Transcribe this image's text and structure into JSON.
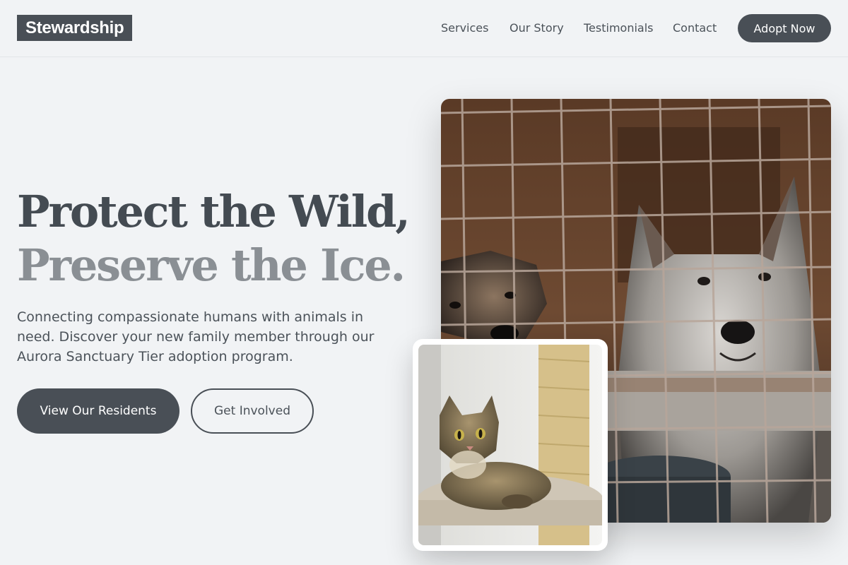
{
  "brand": {
    "logo_text": "Stewardship"
  },
  "nav": {
    "links": [
      "Services",
      "Our Story",
      "Testimonials",
      "Contact"
    ],
    "cta_label": "Adopt Now"
  },
  "hero": {
    "headline_line1": "Protect the Wild,",
    "headline_line2": "Preserve the Ice.",
    "lead": "Connecting compassionate humans with animals in need. Discover your new family member through our Aurora Sanctuary Tier adoption program.",
    "primary_button": "View Our Residents",
    "secondary_button": "Get Involved"
  },
  "images": {
    "main_alt": "Two dogs behind a wire kennel cage",
    "secondary_alt": "Tabby cat resting on a cat tree platform"
  },
  "colors": {
    "background": "#f1f3f5",
    "primary": "#494f56",
    "text_dark": "#444b52",
    "text_muted": "#8a8f94"
  }
}
